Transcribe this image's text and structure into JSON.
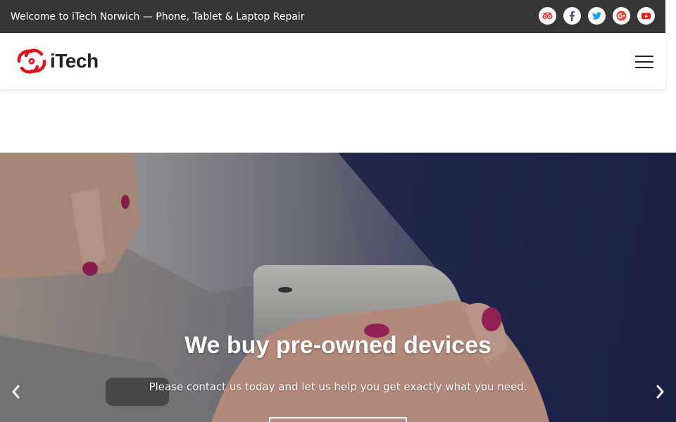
{
  "topbar": {
    "welcome_text": "Welcome to iTech Norwich — Phone, Tablet & Laptop Repair",
    "social": [
      {
        "icon": "tripadvisor-icon",
        "color": "#e8281e"
      },
      {
        "icon": "facebook-icon",
        "color": "#3b5998"
      },
      {
        "icon": "twitter-icon",
        "color": "#1da1f2"
      },
      {
        "icon": "google-plus-icon",
        "color": "#dd4b39"
      },
      {
        "icon": "youtube-icon",
        "color": "#e62117"
      }
    ]
  },
  "header": {
    "logo_text": "iTech",
    "logo_color": "#e0141c",
    "menu_icon": "hamburger-icon"
  },
  "hero": {
    "title": "We buy pre-owned devices",
    "subtitle": "Please contact us today and let us help you get exactly what you need.",
    "prev_icon": "chevron-left-icon",
    "next_icon": "chevron-right-icon"
  }
}
